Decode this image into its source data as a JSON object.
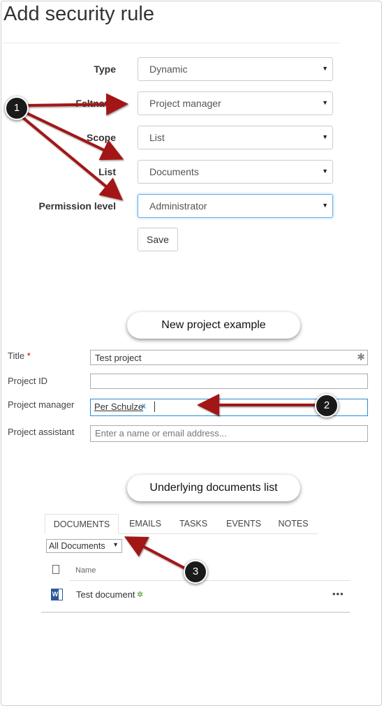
{
  "page": {
    "title": "Add security rule"
  },
  "rule_form": {
    "fields": [
      {
        "label": "Type",
        "value": "Dynamic"
      },
      {
        "label": "Feltnavn",
        "value": "Project manager"
      },
      {
        "label": "Scope",
        "value": "List"
      },
      {
        "label": "List",
        "value": "Documents"
      },
      {
        "label": "Permission level",
        "value": "Administrator"
      }
    ],
    "save_label": "Save"
  },
  "callouts": {
    "new_project": "New project example",
    "underlying_docs": "Underlying documents list"
  },
  "project_form": {
    "title_label": "Title",
    "required_mark": "*",
    "title_value": "Test project",
    "project_id_label": "Project ID",
    "project_id_value": "",
    "project_manager_label": "Project manager",
    "project_manager_token": "Per Schulze",
    "token_remove": "x",
    "project_assistant_label": "Project assistant",
    "project_assistant_placeholder": "Enter a name or email address..."
  },
  "tabs": [
    "DOCUMENTS",
    "EMAILS",
    "TASKS",
    "EVENTS",
    "NOTES"
  ],
  "documents": {
    "view": "All Documents",
    "column_name": "Name",
    "rows": [
      {
        "name": "Test document",
        "icon": "word-doc-icon"
      }
    ],
    "more": "•••"
  },
  "badges": [
    "1",
    "2",
    "3"
  ],
  "colors": {
    "arrow": "#a31515",
    "focus_border": "#66afe9",
    "word_blue": "#2b579a"
  }
}
